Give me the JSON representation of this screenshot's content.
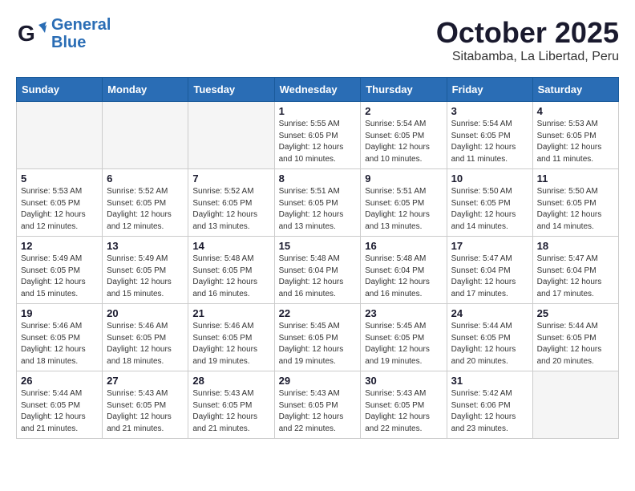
{
  "header": {
    "logo_line1": "General",
    "logo_line2": "Blue",
    "month": "October 2025",
    "location": "Sitabamba, La Libertad, Peru"
  },
  "weekdays": [
    "Sunday",
    "Monday",
    "Tuesday",
    "Wednesday",
    "Thursday",
    "Friday",
    "Saturday"
  ],
  "weeks": [
    [
      {
        "day": "",
        "info": ""
      },
      {
        "day": "",
        "info": ""
      },
      {
        "day": "",
        "info": ""
      },
      {
        "day": "1",
        "info": "Sunrise: 5:55 AM\nSunset: 6:05 PM\nDaylight: 12 hours\nand 10 minutes."
      },
      {
        "day": "2",
        "info": "Sunrise: 5:54 AM\nSunset: 6:05 PM\nDaylight: 12 hours\nand 10 minutes."
      },
      {
        "day": "3",
        "info": "Sunrise: 5:54 AM\nSunset: 6:05 PM\nDaylight: 12 hours\nand 11 minutes."
      },
      {
        "day": "4",
        "info": "Sunrise: 5:53 AM\nSunset: 6:05 PM\nDaylight: 12 hours\nand 11 minutes."
      }
    ],
    [
      {
        "day": "5",
        "info": "Sunrise: 5:53 AM\nSunset: 6:05 PM\nDaylight: 12 hours\nand 12 minutes."
      },
      {
        "day": "6",
        "info": "Sunrise: 5:52 AM\nSunset: 6:05 PM\nDaylight: 12 hours\nand 12 minutes."
      },
      {
        "day": "7",
        "info": "Sunrise: 5:52 AM\nSunset: 6:05 PM\nDaylight: 12 hours\nand 13 minutes."
      },
      {
        "day": "8",
        "info": "Sunrise: 5:51 AM\nSunset: 6:05 PM\nDaylight: 12 hours\nand 13 minutes."
      },
      {
        "day": "9",
        "info": "Sunrise: 5:51 AM\nSunset: 6:05 PM\nDaylight: 12 hours\nand 13 minutes."
      },
      {
        "day": "10",
        "info": "Sunrise: 5:50 AM\nSunset: 6:05 PM\nDaylight: 12 hours\nand 14 minutes."
      },
      {
        "day": "11",
        "info": "Sunrise: 5:50 AM\nSunset: 6:05 PM\nDaylight: 12 hours\nand 14 minutes."
      }
    ],
    [
      {
        "day": "12",
        "info": "Sunrise: 5:49 AM\nSunset: 6:05 PM\nDaylight: 12 hours\nand 15 minutes."
      },
      {
        "day": "13",
        "info": "Sunrise: 5:49 AM\nSunset: 6:05 PM\nDaylight: 12 hours\nand 15 minutes."
      },
      {
        "day": "14",
        "info": "Sunrise: 5:48 AM\nSunset: 6:05 PM\nDaylight: 12 hours\nand 16 minutes."
      },
      {
        "day": "15",
        "info": "Sunrise: 5:48 AM\nSunset: 6:04 PM\nDaylight: 12 hours\nand 16 minutes."
      },
      {
        "day": "16",
        "info": "Sunrise: 5:48 AM\nSunset: 6:04 PM\nDaylight: 12 hours\nand 16 minutes."
      },
      {
        "day": "17",
        "info": "Sunrise: 5:47 AM\nSunset: 6:04 PM\nDaylight: 12 hours\nand 17 minutes."
      },
      {
        "day": "18",
        "info": "Sunrise: 5:47 AM\nSunset: 6:04 PM\nDaylight: 12 hours\nand 17 minutes."
      }
    ],
    [
      {
        "day": "19",
        "info": "Sunrise: 5:46 AM\nSunset: 6:05 PM\nDaylight: 12 hours\nand 18 minutes."
      },
      {
        "day": "20",
        "info": "Sunrise: 5:46 AM\nSunset: 6:05 PM\nDaylight: 12 hours\nand 18 minutes."
      },
      {
        "day": "21",
        "info": "Sunrise: 5:46 AM\nSunset: 6:05 PM\nDaylight: 12 hours\nand 19 minutes."
      },
      {
        "day": "22",
        "info": "Sunrise: 5:45 AM\nSunset: 6:05 PM\nDaylight: 12 hours\nand 19 minutes."
      },
      {
        "day": "23",
        "info": "Sunrise: 5:45 AM\nSunset: 6:05 PM\nDaylight: 12 hours\nand 19 minutes."
      },
      {
        "day": "24",
        "info": "Sunrise: 5:44 AM\nSunset: 6:05 PM\nDaylight: 12 hours\nand 20 minutes."
      },
      {
        "day": "25",
        "info": "Sunrise: 5:44 AM\nSunset: 6:05 PM\nDaylight: 12 hours\nand 20 minutes."
      }
    ],
    [
      {
        "day": "26",
        "info": "Sunrise: 5:44 AM\nSunset: 6:05 PM\nDaylight: 12 hours\nand 21 minutes."
      },
      {
        "day": "27",
        "info": "Sunrise: 5:43 AM\nSunset: 6:05 PM\nDaylight: 12 hours\nand 21 minutes."
      },
      {
        "day": "28",
        "info": "Sunrise: 5:43 AM\nSunset: 6:05 PM\nDaylight: 12 hours\nand 21 minutes."
      },
      {
        "day": "29",
        "info": "Sunrise: 5:43 AM\nSunset: 6:05 PM\nDaylight: 12 hours\nand 22 minutes."
      },
      {
        "day": "30",
        "info": "Sunrise: 5:43 AM\nSunset: 6:05 PM\nDaylight: 12 hours\nand 22 minutes."
      },
      {
        "day": "31",
        "info": "Sunrise: 5:42 AM\nSunset: 6:06 PM\nDaylight: 12 hours\nand 23 minutes."
      },
      {
        "day": "",
        "info": ""
      }
    ]
  ]
}
